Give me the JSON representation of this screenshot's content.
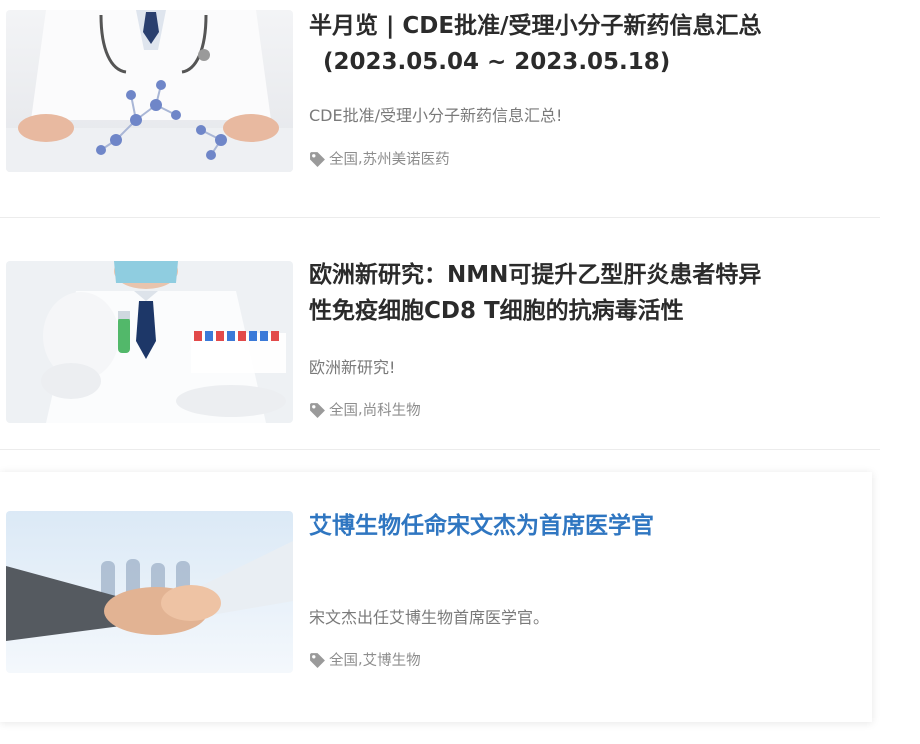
{
  "articles": [
    {
      "title_line1": "半月览 | CDE批准/受理小分子新药信息汇总",
      "title_line2": "(2023.05.04 ~ 2023.05.18)",
      "summary": "CDE批准/受理小分子新药信息汇总!",
      "tags": [
        "全国",
        "苏州美诺医药"
      ],
      "image": "doctor-molecule-model-image"
    },
    {
      "title_line1": "欧洲新研究：NMN可提升乙型肝炎患者特异",
      "title_line2": "性免疫细胞CD8 T细胞的抗病毒活性",
      "summary": "欧洲新研究!",
      "tags": [
        "全国",
        "尚科生物"
      ],
      "image": "doctor-test-tubes-image"
    },
    {
      "title_line1": "艾博生物任命宋文杰为首席医学官",
      "summary": "宋文杰出任艾博生物首席医学官。",
      "tags": [
        "全国",
        "艾博生物"
      ],
      "image": "handshake-image",
      "title_color": "#2f76c1"
    }
  ],
  "icons": {
    "tag": "tag-icon"
  },
  "colors": {
    "title": "#2b2b2b",
    "title_active": "#2f76c1",
    "meta": "#8d8d8d"
  }
}
